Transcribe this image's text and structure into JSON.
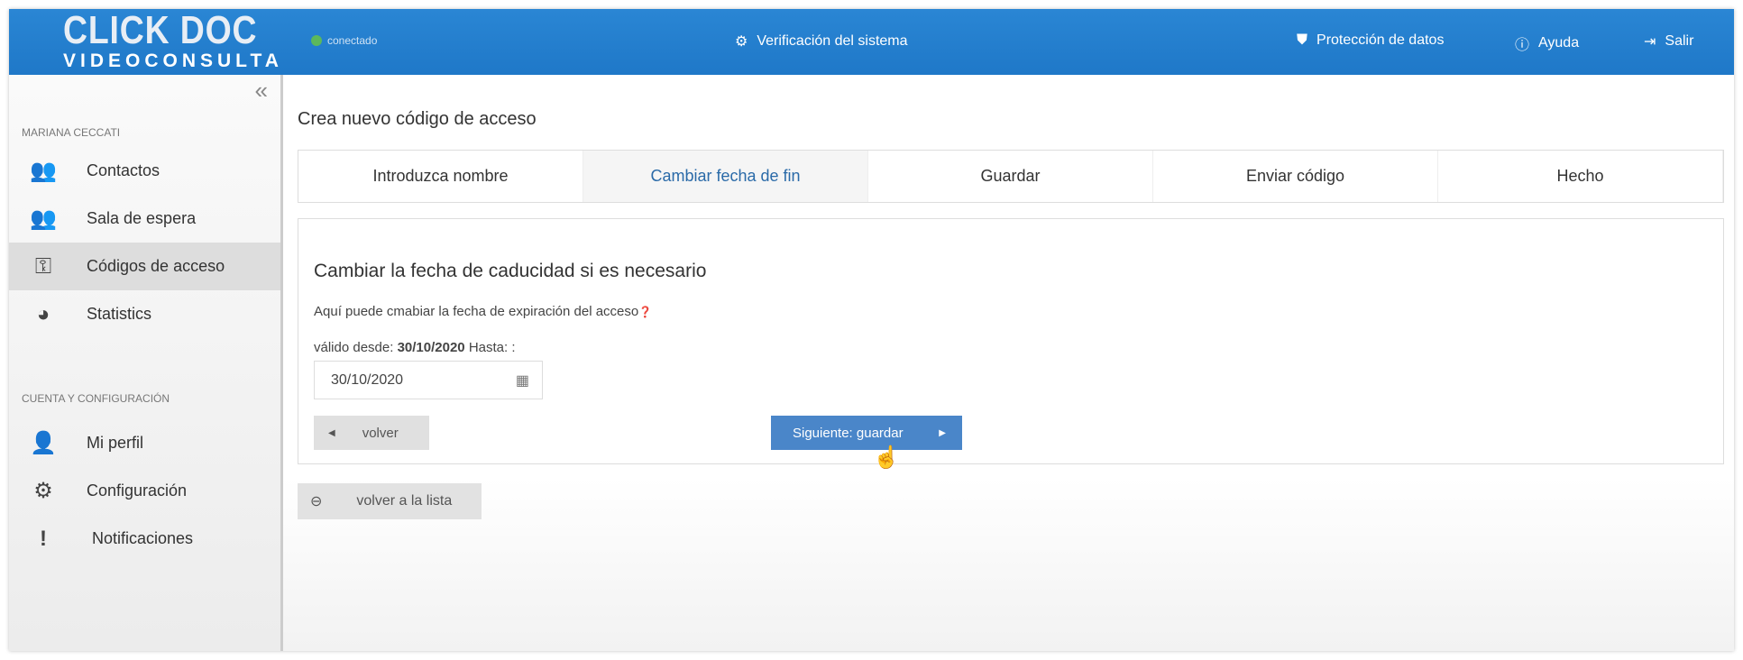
{
  "header": {
    "logo_top": "CLICK DOC",
    "logo_bottom": "VIDEOCONSULTA",
    "status": "conectado",
    "status_color": "#5cb85c",
    "system_check": "Verificación del sistema",
    "data_protection": "Protección de datos",
    "help": "Ayuda",
    "logout": "Salir"
  },
  "sidebar": {
    "user": "MARIANA CECCATI",
    "items": [
      {
        "label": "Contactos",
        "icon": "users-icon"
      },
      {
        "label": "Sala de espera",
        "icon": "group-icon"
      },
      {
        "label": "Códigos de acceso",
        "icon": "key-icon",
        "active": true
      },
      {
        "label": "Statistics",
        "icon": "pie-chart-icon"
      }
    ],
    "section2": "CUENTA Y CONFIGURACIÓN",
    "items2": [
      {
        "label": "Mi perfil",
        "icon": "user-icon"
      },
      {
        "label": "Configuración",
        "icon": "gear-icon"
      },
      {
        "label": "Notificaciones",
        "icon": "exclamation-icon"
      }
    ]
  },
  "main": {
    "title": "Crea nuevo código de acceso",
    "steps": [
      "Introduzca nombre",
      "Cambiar fecha de fin",
      "Guardar",
      "Enviar código",
      "Hecho"
    ],
    "active_step": 1,
    "heading": "Cambiar la fecha de caducidad si es necesario",
    "description": "Aquí puede cmabiar la fecha de expiración del acceso",
    "valid_from_label": "válido desde:",
    "valid_from": "30/10/2020",
    "until_label": "Hasta: :",
    "date_value": "30/10/2020",
    "back": "volver",
    "next": "Siguiente: guardar",
    "back_to_list": "volver a la lista"
  }
}
